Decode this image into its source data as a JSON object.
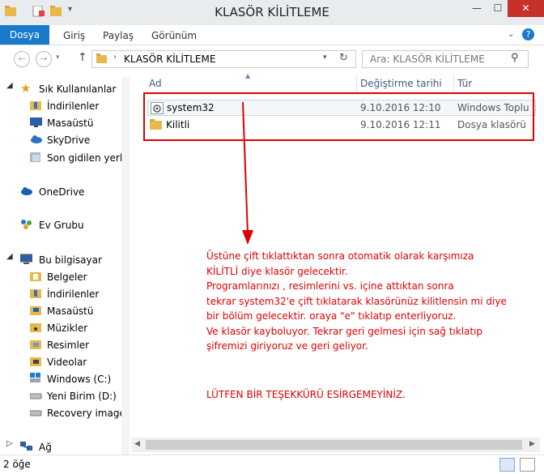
{
  "window": {
    "title": "KLASÖR KİLİTLEME",
    "minimize": "—",
    "maximize": "☐",
    "close": "✕"
  },
  "ribbon": {
    "tabs": [
      "Dosya",
      "Giriş",
      "Paylaş",
      "Görünüm"
    ]
  },
  "address": {
    "path": "KLASÖR KİLİTLEME",
    "search_placeholder": "Ara: KLASÖR KİLİTLEME"
  },
  "nav": {
    "favorites": "Sık Kullanılanlar",
    "favorite_items": [
      "İndirilenler",
      "Masaüstü",
      "SkyDrive",
      "Son gidilen yerler"
    ],
    "onedrive": "OneDrive",
    "homegroup": "Ev Grubu",
    "computer": "Bu bilgisayar",
    "computer_items": [
      "Belgeler",
      "İndirilenler",
      "Masaüstü",
      "Müzikler",
      "Resimler",
      "Videolar",
      "Windows (C:)",
      "Yeni Birim (D:)",
      "Recovery image"
    ],
    "network": "Ağ"
  },
  "columns": {
    "name": "Ad",
    "date": "Değiştirme tarihi",
    "type": "Tür"
  },
  "files": [
    {
      "name": "system32",
      "date": "9.10.2016 12:10",
      "type": "Windows Toplu İş"
    },
    {
      "name": "Kilitli",
      "date": "9.10.2016 12:11",
      "type": "Dosya klasörü"
    }
  ],
  "annotation": {
    "lines": [
      "Üstüne çift tıklattıktan sonra otomatik olarak karşımıza",
      "KİLİTLİ diye klasör gelecektir.",
      "Programlarınızı , resimlerini vs. içine attıktan sonra",
      "tekrar system32'e çift tıklatarak klasörünüz kilitlensin mi diye",
      "bir bölüm gelecektir. oraya \"e\" tıklatıp enterliyoruz.",
      "Ve klasör kayboluyor. Tekrar geri gelmesi için sağ tıklatıp",
      "şifremizi giriyoruz ve geri geliyor."
    ],
    "thanks": "LÜTFEN BİR TEŞEKKÜRÜ ESİRGEMEYİNİZ.",
    "color": "#e00000"
  },
  "status": {
    "count": "2 öğe"
  },
  "colors": {
    "accent": "#1979ca",
    "close_button": "#c7312b",
    "folder": "#e8b84a"
  }
}
